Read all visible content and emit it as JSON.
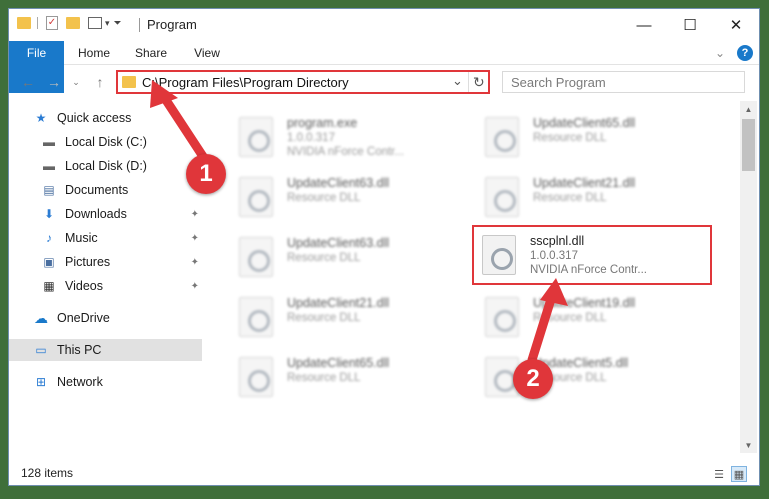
{
  "window": {
    "title": "Program",
    "controls": {
      "minimize": "—",
      "maximize": "☐",
      "close": "✕"
    }
  },
  "ribbon": {
    "tabs": [
      "File",
      "Home",
      "Share",
      "View"
    ],
    "help": "?",
    "expand": "⌄"
  },
  "address": {
    "path": "C:\\Program Files\\Program Directory",
    "refresh": "↻",
    "dropdown": "⌄"
  },
  "search": {
    "placeholder": "Search Program"
  },
  "sidebar": {
    "items": [
      {
        "label": "Quick access",
        "icon": "star-icon",
        "glyph": "★"
      },
      {
        "label": "Local Disk (C:)",
        "icon": "drive-icon",
        "glyph": "▬"
      },
      {
        "label": "Local Disk (D:)",
        "icon": "drive-icon",
        "glyph": "▬"
      },
      {
        "label": "Documents",
        "icon": "documents-icon",
        "glyph": "▤"
      },
      {
        "label": "Downloads",
        "icon": "downloads-icon",
        "glyph": "⬇"
      },
      {
        "label": "Music",
        "icon": "music-icon",
        "glyph": "♪"
      },
      {
        "label": "Pictures",
        "icon": "pictures-icon",
        "glyph": "▣"
      },
      {
        "label": "Videos",
        "icon": "videos-icon",
        "glyph": "▦"
      },
      {
        "label": "OneDrive",
        "icon": "cloud-icon",
        "glyph": "☁"
      },
      {
        "label": "This PC",
        "icon": "computer-icon",
        "glyph": "▭"
      },
      {
        "label": "Network",
        "icon": "network-icon",
        "glyph": "⊞"
      }
    ]
  },
  "files": [
    {
      "name": "program.exe",
      "line2": "1.0.0.317",
      "line3": "NVIDIA nForce Contr..."
    },
    {
      "name": "UpdateClient65.dll",
      "line2": "Resource DLL",
      "line3": ""
    },
    {
      "name": "UpdateClient63.dll",
      "line2": "Resource DLL",
      "line3": ""
    },
    {
      "name": "UpdateClient21.dll",
      "line2": "Resource DLL",
      "line3": ""
    },
    {
      "name": "UpdateClient63.dll",
      "line2": "Resource DLL",
      "line3": ""
    },
    {
      "name": "sscplnl.dll",
      "line2": "1.0.0.317",
      "line3": "NVIDIA nForce Contr..."
    },
    {
      "name": "UpdateClient21.dll",
      "line2": "Resource DLL",
      "line3": ""
    },
    {
      "name": "UpdateClient19.dll",
      "line2": "Resource DLL",
      "line3": ""
    },
    {
      "name": "UpdateClient65.dll",
      "line2": "Resource DLL",
      "line3": ""
    },
    {
      "name": "UpdateClient5.dll",
      "line2": "Resource DLL",
      "line3": ""
    }
  ],
  "status": {
    "items_count": "128 items"
  },
  "annotations": {
    "step1": "1",
    "step2": "2",
    "color": "#e0363a"
  }
}
